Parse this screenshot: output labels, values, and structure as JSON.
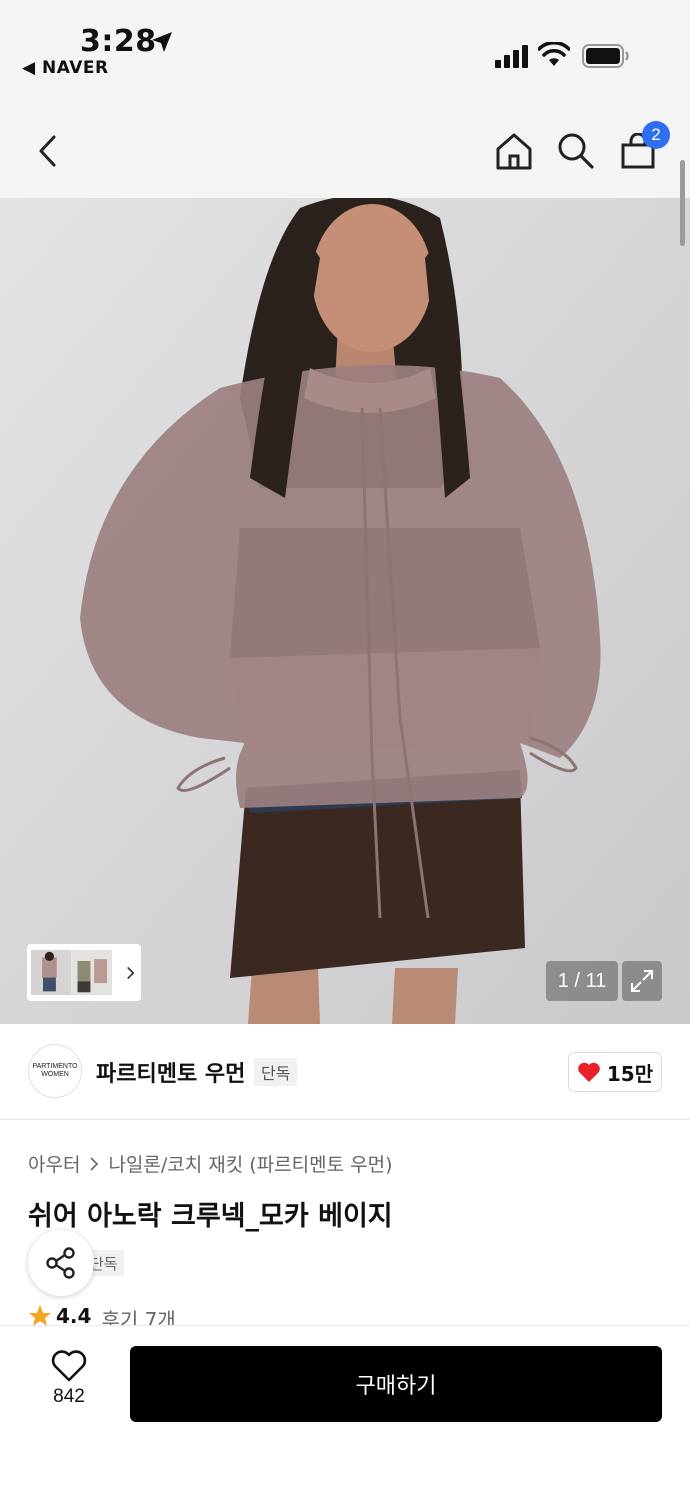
{
  "status_bar": {
    "time": "3:28",
    "back_app": "◀ NAVER"
  },
  "navbar": {
    "cart_count": "2"
  },
  "gallery": {
    "counter": "1 / 11"
  },
  "brand": {
    "logo_line1": "PARTIMENTO",
    "logo_line2": "WOMEN",
    "name": "파르티멘토 우먼",
    "tag": "단독",
    "likes": "15만"
  },
  "product": {
    "breadcrumb": [
      "아우터",
      "나일론/코치 재킷 (파르티멘토 우먼)"
    ],
    "title": "쉬어 아노락 크루넥_모카 베이지",
    "tag": "단독",
    "rating": "4.4",
    "reviews": "후기 7개"
  },
  "bottom_bar": {
    "wish_count": "842",
    "buy_label": "구매하기"
  },
  "colors": {
    "badge": "#2e6ff2",
    "heart": "#e8212b",
    "star": "#f5a623",
    "buy_button": "#000000"
  },
  "icons": [
    "location-arrow-icon",
    "signal-icon",
    "wifi-icon",
    "battery-icon",
    "back-chevron-icon",
    "home-icon",
    "search-icon",
    "cart-icon",
    "expand-icon",
    "heart-icon",
    "share-icon",
    "star-icon",
    "wish-heart-icon"
  ]
}
